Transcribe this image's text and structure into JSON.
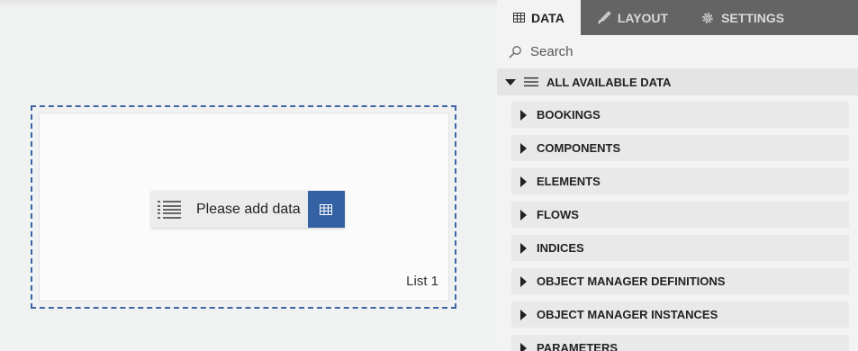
{
  "canvas": {
    "placeholder_text": "Please add data",
    "widget_name": "List 1"
  },
  "tabs": [
    {
      "label": "DATA",
      "icon": "table-icon",
      "active": true
    },
    {
      "label": "LAYOUT",
      "icon": "brush-icon",
      "active": false
    },
    {
      "label": "SETTINGS",
      "icon": "gear-icon",
      "active": false
    }
  ],
  "search": {
    "placeholder": "Search",
    "value": ""
  },
  "group": {
    "label": "ALL AVAILABLE DATA",
    "expanded": true
  },
  "items": [
    {
      "label": "BOOKINGS"
    },
    {
      "label": "COMPONENTS"
    },
    {
      "label": "ELEMENTS"
    },
    {
      "label": "FLOWS"
    },
    {
      "label": "INDICES"
    },
    {
      "label": "OBJECT MANAGER DEFINITIONS"
    },
    {
      "label": "OBJECT MANAGER INSTANCES"
    },
    {
      "label": "PARAMETERS"
    }
  ],
  "colors": {
    "accent": "#3461a4",
    "tabbar": "#646464",
    "frame": "#3d65a6"
  }
}
